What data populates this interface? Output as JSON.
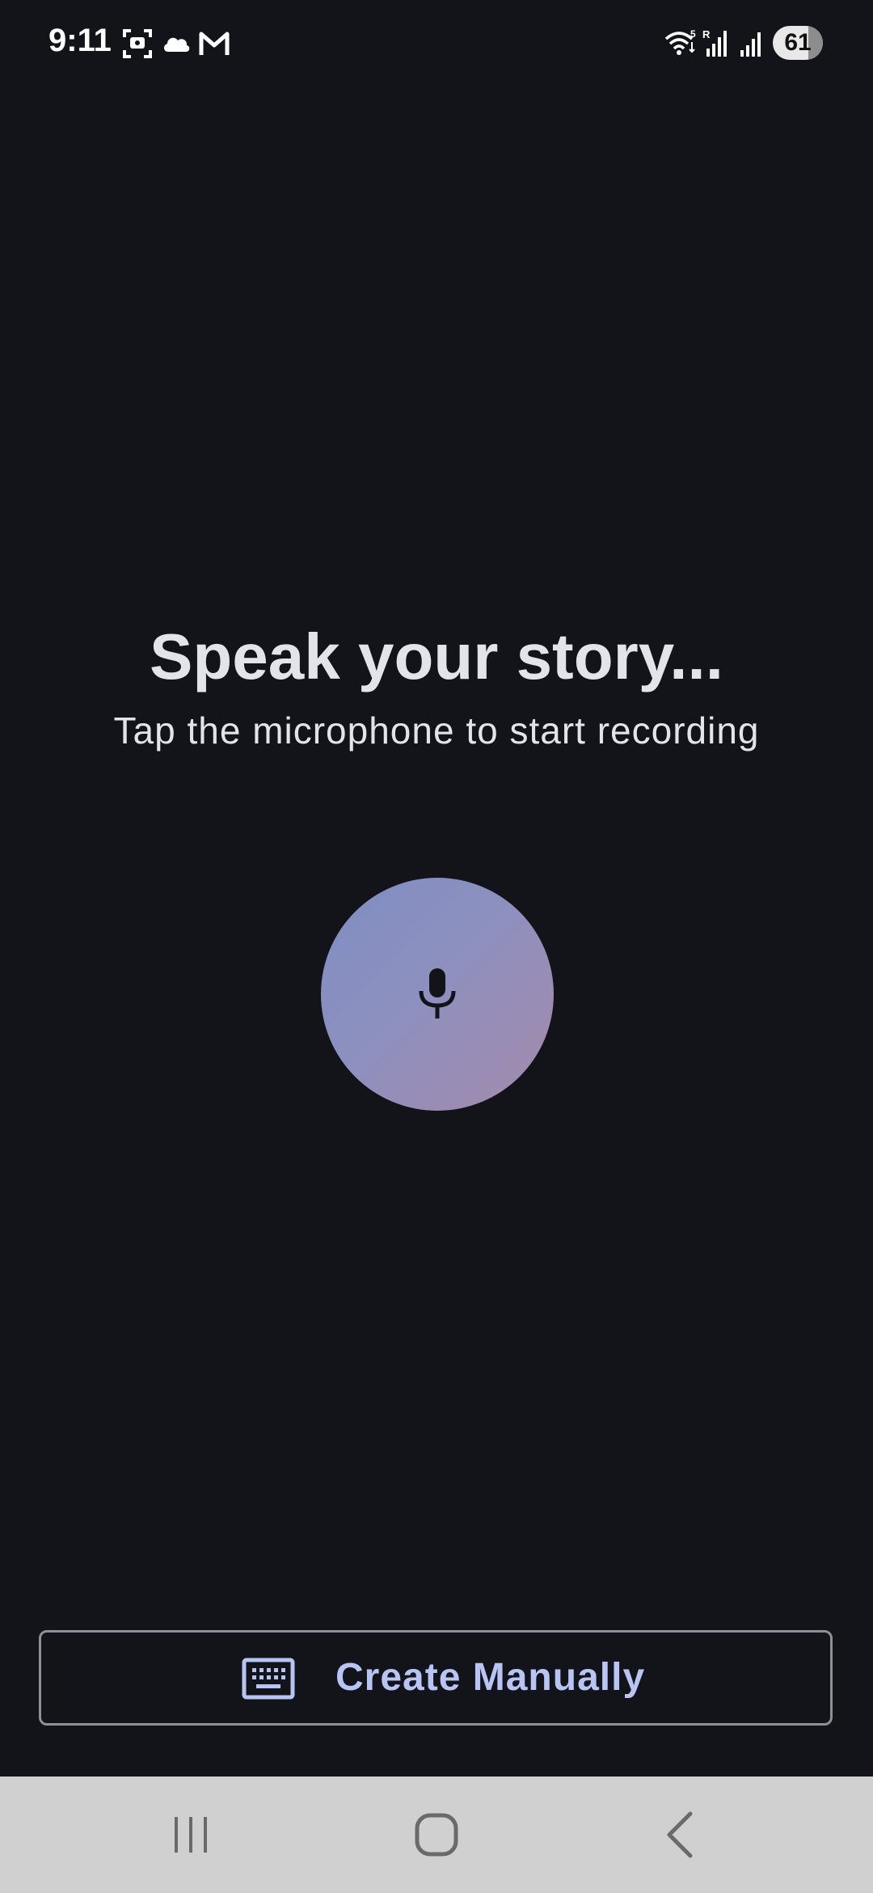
{
  "status_bar": {
    "time": "9:11",
    "battery": "61",
    "icons": [
      "screenshot-icon",
      "cloud-icon",
      "gmail-icon",
      "wifi-icon",
      "signal-icon",
      "signal-icon-2"
    ]
  },
  "main": {
    "title": "Speak your story...",
    "subtitle": "Tap the microphone to start recording",
    "mic_button_icon": "microphone-icon"
  },
  "actions": {
    "create_manually_label": "Create Manually",
    "create_manually_icon": "keyboard-icon"
  },
  "nav_bar": {
    "items": [
      "recent-apps",
      "home",
      "back"
    ]
  },
  "colors": {
    "background": "#131419",
    "accent_text": "#b8c4f4",
    "mic_gradient_start": "#7f8ec2",
    "mic_gradient_end": "#a58aab",
    "nav_bar": "#d0d0d0"
  }
}
